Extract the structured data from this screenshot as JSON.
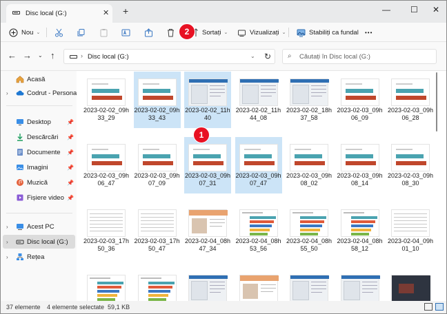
{
  "tab": {
    "title": "Disc local (G:)"
  },
  "window": {
    "minimize": "—",
    "maximize": "☐",
    "close": "✕",
    "new_tab": "+",
    "tab_close": "✕"
  },
  "toolbar": {
    "new_label": "Nou",
    "sort_label": "Sortați",
    "view_label": "Vizualizați",
    "background_label": "Stabiliți ca fundal",
    "more_label": "•••"
  },
  "address": {
    "path": "Disc local (G:)"
  },
  "search": {
    "placeholder": "Căutați în Disc local (G:)"
  },
  "annotations": [
    "1",
    "2"
  ],
  "sidebar": {
    "items": [
      {
        "label": "Acasă",
        "icon": "home-icon"
      },
      {
        "label": "Codrut - Personal",
        "icon": "cloud-icon"
      },
      {
        "label": "Desktop",
        "icon": "desktop-icon"
      },
      {
        "label": "Descărcări",
        "icon": "download-icon"
      },
      {
        "label": "Documente",
        "icon": "document-icon"
      },
      {
        "label": "Imagini",
        "icon": "image-icon"
      },
      {
        "label": "Muzică",
        "icon": "music-icon"
      },
      {
        "label": "Fișiere video",
        "icon": "video-icon"
      },
      {
        "label": "Acest PC",
        "icon": "computer-icon"
      },
      {
        "label": "Disc local (G:)",
        "icon": "drive-icon"
      },
      {
        "label": "Rețea",
        "icon": "network-icon"
      }
    ]
  },
  "files": [
    {
      "name": "2023-02-02_09h33_29",
      "selected": false,
      "kind": "chart"
    },
    {
      "name": "2023-02-02_09h33_43",
      "selected": true,
      "kind": "chart"
    },
    {
      "name": "2023-02-02_11h40",
      "selected": true,
      "kind": "shot"
    },
    {
      "name": "2023-02-02_11h44_08",
      "selected": false,
      "kind": "shot"
    },
    {
      "name": "2023-02-02_18h37_58",
      "selected": false,
      "kind": "shot"
    },
    {
      "name": "2023-02-03_09h06_09",
      "selected": false,
      "kind": "chart"
    },
    {
      "name": "2023-02-03_09h06_28",
      "selected": false,
      "kind": "chart"
    },
    {
      "name": "2023-02-03_09h06_47",
      "selected": false,
      "kind": "chart"
    },
    {
      "name": "2023-02-03_09h07_09",
      "selected": false,
      "kind": "chart"
    },
    {
      "name": "2023-02-03_09h07_31",
      "selected": true,
      "kind": "chart"
    },
    {
      "name": "2023-02-03_09h07_47",
      "selected": true,
      "kind": "chart"
    },
    {
      "name": "2023-02-03_09h08_02",
      "selected": false,
      "kind": "chart"
    },
    {
      "name": "2023-02-03_09h08_14",
      "selected": false,
      "kind": "chart"
    },
    {
      "name": "2023-02-03_09h08_30",
      "selected": false,
      "kind": "chart"
    },
    {
      "name": "2023-02-03_17h50_36",
      "selected": false,
      "kind": "table"
    },
    {
      "name": "2023-02-03_17h50_47",
      "selected": false,
      "kind": "table"
    },
    {
      "name": "2023-02-04_08h47_34",
      "selected": false,
      "kind": "doc"
    },
    {
      "name": "2023-02-04_08h53_56",
      "selected": false,
      "kind": "bars"
    },
    {
      "name": "2023-02-04_08h55_50",
      "selected": false,
      "kind": "bars"
    },
    {
      "name": "2023-02-04_08h58_12",
      "selected": false,
      "kind": "bars"
    },
    {
      "name": "2023-02-04_09h01_10",
      "selected": false,
      "kind": "table"
    },
    {
      "name": "",
      "selected": false,
      "kind": "bars"
    },
    {
      "name": "",
      "selected": false,
      "kind": "bars"
    },
    {
      "name": "",
      "selected": false,
      "kind": "shot"
    },
    {
      "name": "",
      "selected": false,
      "kind": "doc"
    },
    {
      "name": "",
      "selected": false,
      "kind": "shot"
    },
    {
      "name": "",
      "selected": false,
      "kind": "shot"
    },
    {
      "name": "",
      "selected": false,
      "kind": "dark"
    }
  ],
  "status": {
    "count": "37 elemente",
    "selection": "4 elemente selectate  59,1 KB"
  },
  "colors": {
    "selection": "#cce4f7",
    "teal_bar": "#4aa3b0",
    "red_bar": "#c0472c",
    "badge": "#e81123"
  }
}
